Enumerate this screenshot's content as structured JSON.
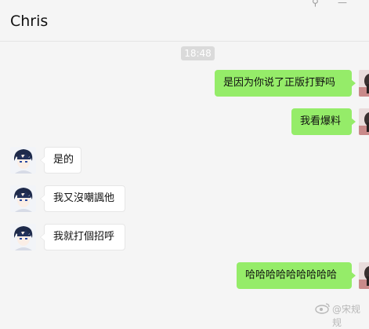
{
  "header": {
    "title": "Chris",
    "pin_glyph": "⚲",
    "minimize_glyph": "—"
  },
  "timestamp": "18:48",
  "messages": [
    {
      "direction": "out",
      "text": "是因为你说了正版打野吗"
    },
    {
      "direction": "out",
      "text": "我看爆料"
    },
    {
      "direction": "in",
      "text": "是的"
    },
    {
      "direction": "in",
      "text": "我又沒嘲諷他"
    },
    {
      "direction": "in",
      "text": "我就打個招呼"
    },
    {
      "direction": "out",
      "text": "哈哈哈哈哈哈哈哈哈"
    }
  ],
  "watermark": {
    "icon": "weibo-icon",
    "text": "@宋规规"
  },
  "colors": {
    "outgoing_bubble": "#95ec69",
    "incoming_bubble": "#ffffff",
    "background": "#f5f5f5",
    "timestamp_bg": "#dadada"
  },
  "icons": {
    "self_avatar": "dark-figure-avatar-icon",
    "other_avatar": "anime-boy-blue-hair-avatar-icon"
  }
}
